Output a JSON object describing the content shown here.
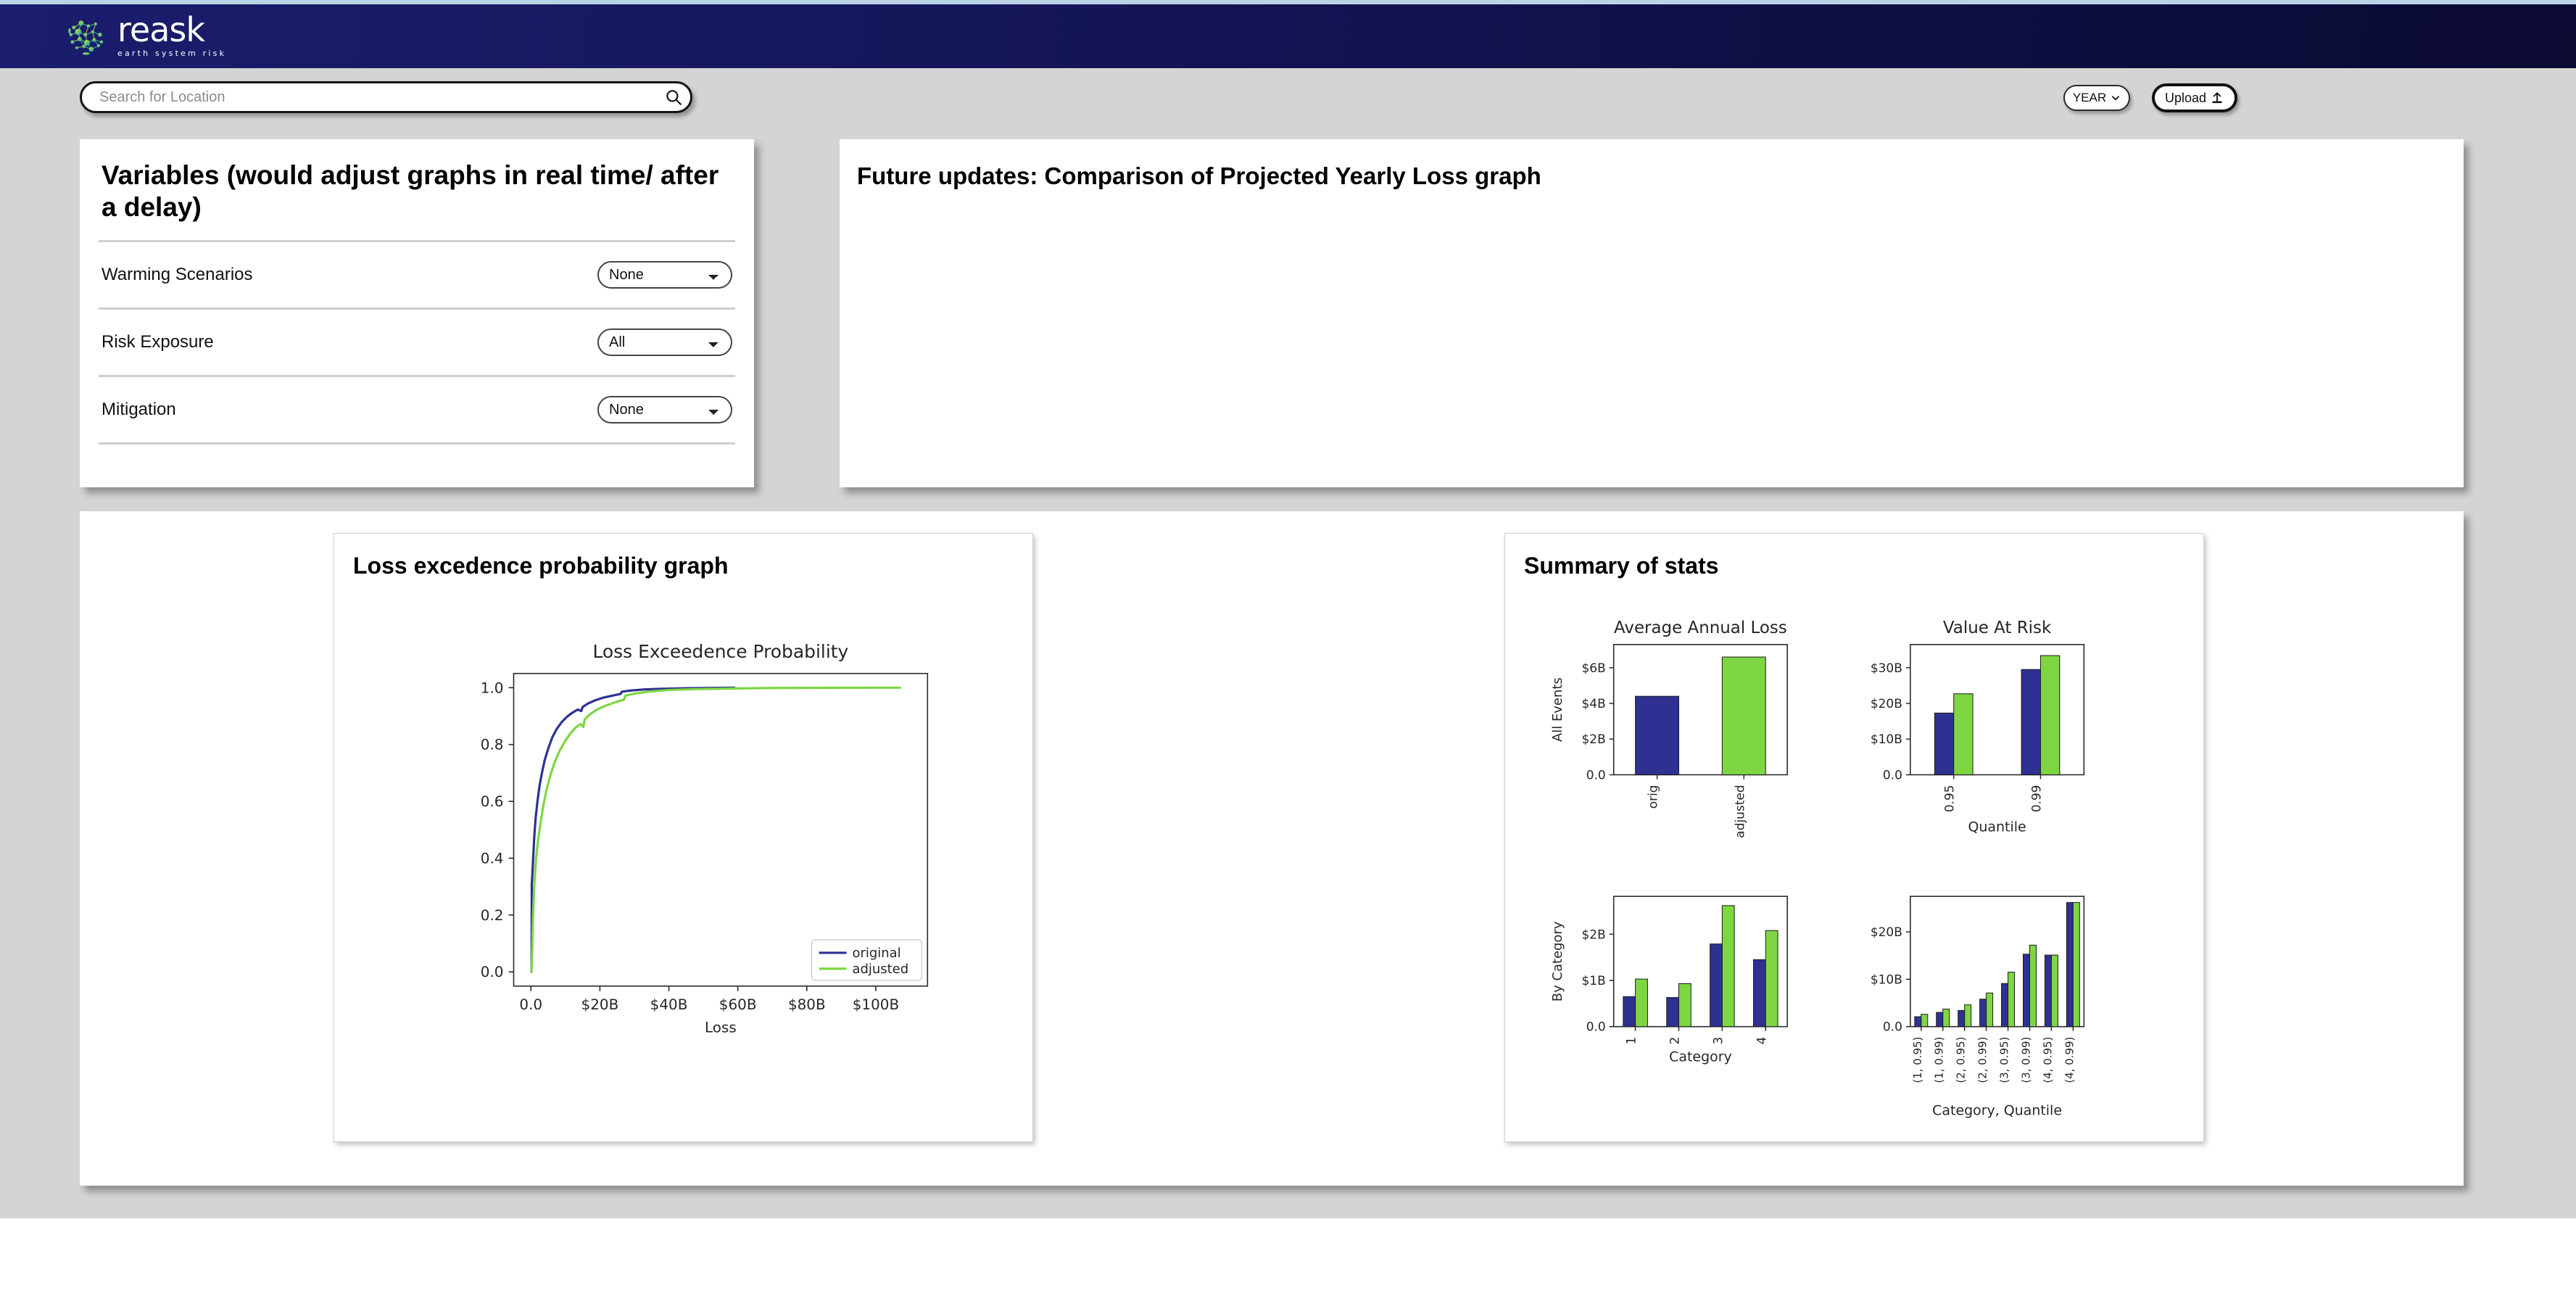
{
  "brand": {
    "name": "reask",
    "tagline": "earth system risk",
    "logo_icon": "globe-network-icon"
  },
  "toolbar": {
    "search_placeholder": "Search for Location",
    "search_value": "",
    "search_icon": "search-icon",
    "year_label": "YEAR",
    "year_icon": "chevron-down-icon",
    "upload_label": "Upload",
    "upload_icon": "upload-icon"
  },
  "variables_panel": {
    "title": "Variables (would adjust graphs in real time/ after a delay)",
    "rows": [
      {
        "label": "Warming Scenarios",
        "value": "None",
        "options": [
          "None"
        ]
      },
      {
        "label": "Risk Exposure",
        "value": "All",
        "options": [
          "All"
        ]
      },
      {
        "label": "Mitigation",
        "value": "None",
        "options": [
          "None"
        ]
      }
    ]
  },
  "future_panel": {
    "title": "Future updates: Comparison of Projected Yearly Loss graph"
  },
  "lep_panel": {
    "title": "Loss excedence probability graph"
  },
  "stats_panel": {
    "title": "Summary of stats"
  },
  "colors": {
    "original": "#2e3192",
    "adjusted": "#7ed642",
    "header_dark": "#0a0a33",
    "header_light": "#1b1d6e",
    "page_bg": "#d4d4d4"
  },
  "chart_data": [
    {
      "type": "line",
      "name": "loss-exceedance-probability",
      "title": "Loss Exceedence Probability",
      "xlabel": "Loss",
      "ylabel": "",
      "xlim": [
        -5,
        115
      ],
      "ylim": [
        -0.05,
        1.05
      ],
      "xtick_labels": [
        "0.0",
        "$20B",
        "$40B",
        "$60B",
        "$80B",
        "$100B"
      ],
      "xtick_values": [
        0,
        20,
        40,
        60,
        80,
        100
      ],
      "ytick_labels": [
        "0.0",
        "0.2",
        "0.4",
        "0.6",
        "0.8",
        "1.0"
      ],
      "ytick_values": [
        0.0,
        0.2,
        0.4,
        0.6,
        0.8,
        1.0
      ],
      "grid": false,
      "legend_position": "lower right",
      "series": [
        {
          "name": "original",
          "color": "#2e3192",
          "x": [
            0.15,
            0.2,
            0.25,
            0.4,
            0.7,
            1.0,
            1.4,
            1.9,
            2.5,
            3.2,
            4.0,
            5.0,
            6.2,
            7.5,
            9.0,
            10.5,
            12.0,
            13.6,
            14.6,
            15.0,
            16.5,
            18.5,
            21.0,
            24.0,
            26.0,
            26.4,
            29.0,
            33.0,
            38.0,
            45.0,
            52.0,
            59.0
          ],
          "y": [
            0.0,
            0.03,
            0.31,
            0.34,
            0.41,
            0.48,
            0.545,
            0.6,
            0.655,
            0.7,
            0.745,
            0.785,
            0.825,
            0.855,
            0.88,
            0.898,
            0.912,
            0.923,
            0.918,
            0.932,
            0.944,
            0.955,
            0.965,
            0.973,
            0.978,
            0.986,
            0.99,
            0.994,
            0.996,
            0.998,
            0.999,
            1.0
          ]
        },
        {
          "name": "adjusted",
          "color": "#7ed642",
          "x": [
            0.15,
            0.3,
            0.6,
            1.0,
            1.5,
            2.1,
            2.8,
            3.6,
            4.5,
            5.6,
            6.8,
            8.2,
            9.8,
            11.4,
            13.0,
            14.4,
            15.2,
            15.6,
            17.0,
            19.0,
            21.5,
            24.5,
            27.0,
            27.4,
            30.0,
            34.0,
            40.0,
            48.0,
            58.0,
            70.0,
            85.0,
            100.0,
            107.0
          ],
          "y": [
            0.0,
            0.04,
            0.19,
            0.31,
            0.4,
            0.465,
            0.525,
            0.585,
            0.64,
            0.69,
            0.735,
            0.775,
            0.81,
            0.838,
            0.86,
            0.872,
            0.862,
            0.888,
            0.905,
            0.922,
            0.936,
            0.949,
            0.958,
            0.972,
            0.979,
            0.986,
            0.992,
            0.995,
            0.997,
            0.999,
            0.9995,
            1.0,
            1.0
          ]
        }
      ]
    },
    {
      "type": "bar",
      "name": "average-annual-loss",
      "title": "Average Annual Loss",
      "xlabel": "",
      "ylabel": "All Events",
      "categories": [
        "orig",
        "adjusted"
      ],
      "values": [
        4.4,
        6.6
      ],
      "bar_colors": [
        "#2e3192",
        "#7ed642"
      ],
      "ytick_labels": [
        "0.0",
        "$2B",
        "$4B",
        "$6B"
      ],
      "ytick_values": [
        0,
        2,
        4,
        6
      ],
      "ylim": [
        0,
        7.3
      ],
      "grid": false
    },
    {
      "type": "bar",
      "name": "value-at-risk",
      "title": "Value At Risk",
      "xlabel": "Quantile",
      "ylabel": "",
      "categories": [
        "0.95",
        "0.99"
      ],
      "series": [
        {
          "name": "original",
          "color": "#2e3192",
          "values": [
            17.3,
            29.5
          ]
        },
        {
          "name": "adjusted",
          "color": "#7ed642",
          "values": [
            22.7,
            33.4
          ]
        }
      ],
      "ytick_labels": [
        "0.0",
        "$10B",
        "$20B",
        "$30B"
      ],
      "ytick_values": [
        0,
        10,
        20,
        30
      ],
      "ylim": [
        0,
        36.5
      ],
      "grid": false
    },
    {
      "type": "bar",
      "name": "loss-by-category",
      "title": "",
      "xlabel": "Category",
      "ylabel": "By Category",
      "categories": [
        "1",
        "2",
        "3",
        "4"
      ],
      "series": [
        {
          "name": "original",
          "color": "#2e3192",
          "values": [
            0.65,
            0.63,
            1.79,
            1.45
          ]
        },
        {
          "name": "adjusted",
          "color": "#7ed642",
          "values": [
            1.03,
            0.93,
            2.62,
            2.08
          ]
        }
      ],
      "ytick_labels": [
        "0.0",
        "$1B",
        "$2B"
      ],
      "ytick_values": [
        0,
        1,
        2
      ],
      "ylim": [
        0,
        2.82
      ],
      "grid": false
    },
    {
      "type": "bar",
      "name": "value-at-risk-by-category",
      "title": "",
      "xlabel": "Category, Quantile",
      "ylabel": "",
      "categories": [
        "(1, 0.95)",
        "(1, 0.99)",
        "(2, 0.95)",
        "(2, 0.99)",
        "(3, 0.95)",
        "(3, 0.99)",
        "(4, 0.95)",
        "(4, 0.99)"
      ],
      "series": [
        {
          "name": "original",
          "color": "#2e3192",
          "values": [
            2.1,
            3.0,
            3.4,
            5.8,
            9.1,
            15.3,
            15.1,
            26.2
          ]
        },
        {
          "name": "adjusted",
          "color": "#7ed642",
          "values": [
            2.6,
            3.7,
            4.6,
            7.1,
            11.5,
            17.2,
            15.1,
            26.2
          ]
        }
      ],
      "ytick_labels": [
        "0.0",
        "$10B",
        "$20B"
      ],
      "ytick_values": [
        0,
        10,
        20
      ],
      "ylim": [
        0,
        27.5
      ],
      "grid": false
    }
  ]
}
